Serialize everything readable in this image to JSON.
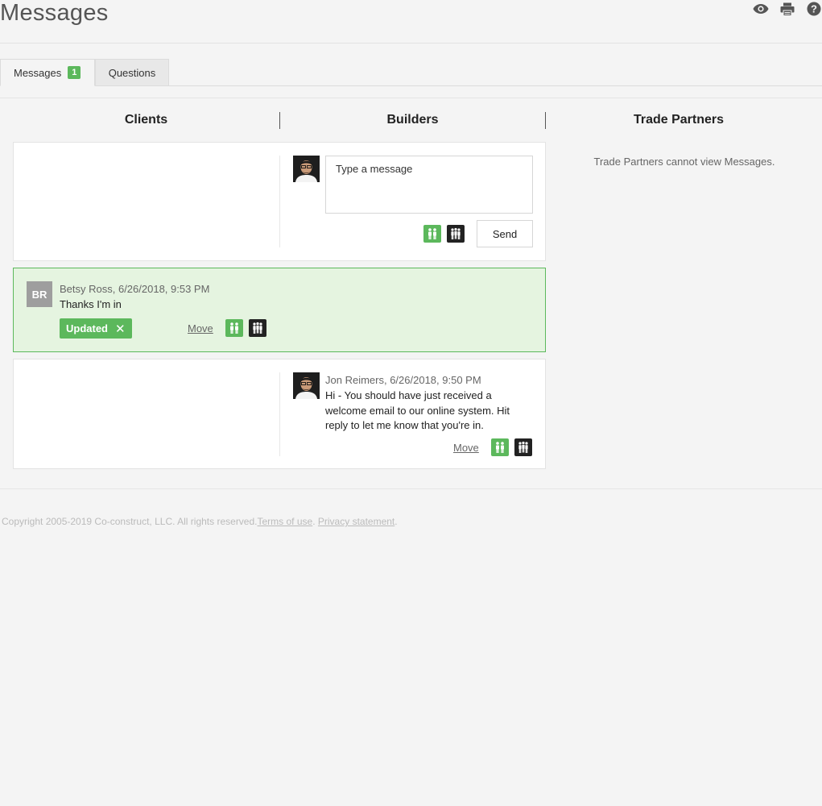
{
  "header": {
    "title": "Messages",
    "icons": [
      "eye-icon",
      "print-icon",
      "help-icon"
    ]
  },
  "tabs": [
    {
      "label": "Messages",
      "badge": "1",
      "active": true
    },
    {
      "label": "Questions",
      "active": false
    }
  ],
  "columns": {
    "clients": "Clients",
    "builders": "Builders",
    "trade_partners": "Trade Partners"
  },
  "composer": {
    "placeholder": "Type a message",
    "send_label": "Send"
  },
  "messages": [
    {
      "initials": "BR",
      "meta": "Betsy Ross, 6/26/2018, 9:53 PM",
      "text": "Thanks I'm in",
      "tag": "Updated",
      "tag_close": "✕",
      "move_label": "Move"
    },
    {
      "meta": "Jon Reimers, 6/26/2018, 9:50 PM",
      "text": "Hi - You should have just received a welcome email to our online system. Hit reply to let me know that you're in.",
      "move_label": "Move"
    }
  ],
  "trade_partners_note": "Trade Partners cannot view Messages.",
  "footer": {
    "copyright": "Copyright 2005-2019 Co-construct, LLC. All rights reserved.",
    "terms": "Terms of use",
    "separator": ".",
    "privacy": "Privacy statement",
    "end": "."
  },
  "colors": {
    "accent_green": "#5cb85c",
    "highlight_bg": "#e5f4e0",
    "dark_icon": "#222222"
  }
}
